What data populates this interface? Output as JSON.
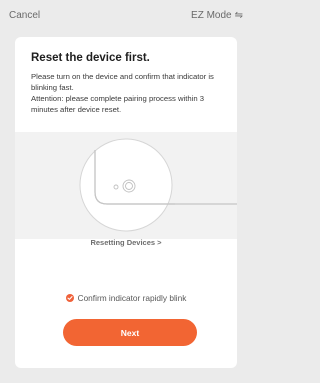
{
  "header": {
    "cancel_label": "Cancel",
    "mode_label": "EZ Mode",
    "mode_switch_icon": "swap-arrows-icon"
  },
  "card": {
    "title": "Reset the device first.",
    "instructions": "Please turn on the device and confirm that indicator is blinking fast.",
    "attention": "Attention: please complete pairing process within 3 minutes after device reset.",
    "illustration_icon": "device-power-button-icon",
    "resetting_link": "Resetting Devices >",
    "confirm_label": "Confirm indicator rapidly blink",
    "confirm_checked": true,
    "next_label": "Next"
  },
  "colors": {
    "accent": "#f26533",
    "background": "#ebebeb",
    "card": "#ffffff"
  }
}
